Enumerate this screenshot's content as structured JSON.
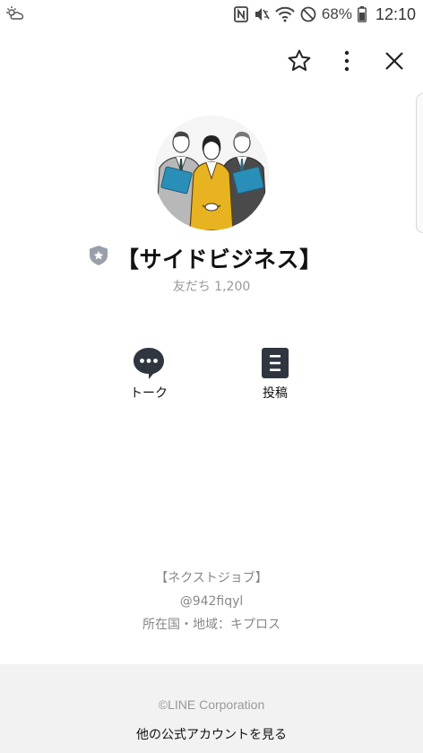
{
  "status_bar": {
    "battery_percent": "68%",
    "time": "12:10"
  },
  "header": {
    "icons": [
      "star-icon",
      "more-vertical-icon",
      "close-icon"
    ]
  },
  "profile": {
    "account_name": "【サイドビジネス】",
    "friends": "友だち 1,200"
  },
  "actions": {
    "talk_label": "トーク",
    "post_label": "投稿"
  },
  "info": {
    "line1": "【ネクストジョブ】",
    "line2": "@942fiqyl",
    "line3": "所在国・地域：キプロス"
  },
  "footer": {
    "copyright": "©LINE Corporation",
    "more_accounts": "他の公式アカウントを見る"
  },
  "colors": {
    "accent_yellow": "#e8b320",
    "footer_bg": "#f2f2f2",
    "icon_dark": "#2f3640"
  }
}
